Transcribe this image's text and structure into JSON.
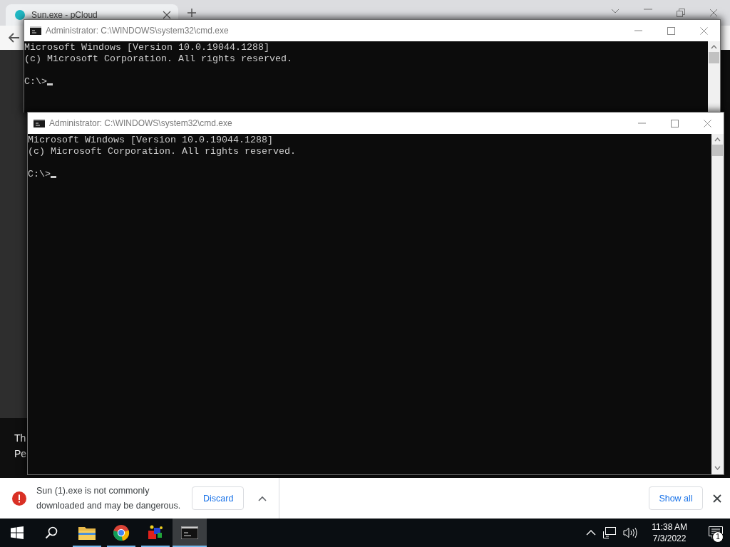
{
  "browser": {
    "tab": {
      "title": "Sun.exe - pCloud"
    },
    "page_text": [
      "Th",
      "Pe"
    ]
  },
  "windows": [
    {
      "title": "Administrator: C:\\WINDOWS\\system32\\cmd.exe",
      "output": [
        "Microsoft Windows [Version 10.0.19044.1288]",
        "(c) Microsoft Corporation. All rights reserved."
      ],
      "prompt": "C:\\>"
    },
    {
      "title": "Administrator: C:\\WINDOWS\\system32\\cmd.exe",
      "output": [
        "Microsoft Windows [Version 10.0.19044.1288]",
        "(c) Microsoft Corporation. All rights reserved."
      ],
      "prompt": "C:\\>"
    }
  ],
  "download_bar": {
    "message_lines": [
      "Sun (1).exe is not commonly",
      "downloaded and may be dangerous."
    ],
    "discard": "Discard",
    "show_all": "Show all"
  },
  "taskbar": {
    "items": [
      {
        "kind": "start",
        "running": false,
        "selected": false
      },
      {
        "kind": "search",
        "running": false,
        "selected": false
      },
      {
        "kind": "folder",
        "running": true,
        "selected": false
      },
      {
        "kind": "chrome",
        "running": true,
        "selected": false
      },
      {
        "kind": "app",
        "running": true,
        "selected": false
      },
      {
        "kind": "cmd",
        "running": true,
        "selected": true
      }
    ],
    "time": "11:38 AM",
    "date": "7/3/2022",
    "notification_count": "1"
  }
}
